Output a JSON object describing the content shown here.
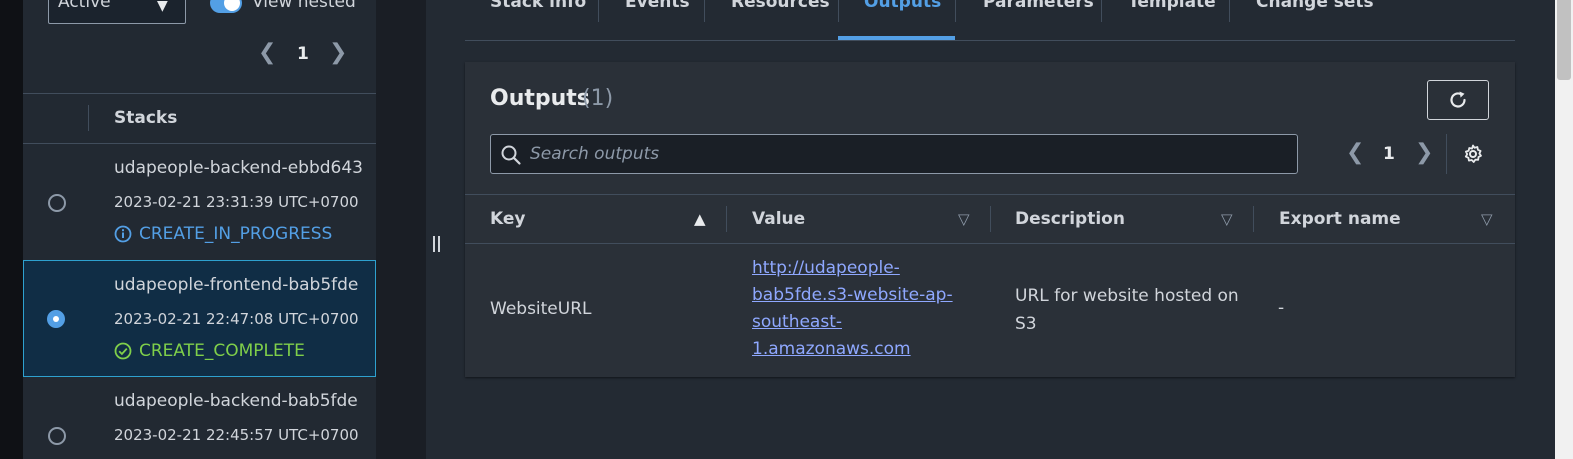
{
  "colors": {
    "accent": "#539fe5",
    "link": "#8fa8ff",
    "in_progress": "#539fe5",
    "complete": "#7fcf4a",
    "selected_border": "#2ea1cf"
  },
  "filter": {
    "select_value": "Active",
    "toggle_label": "View nested",
    "toggle_on": true
  },
  "stacks_pager": {
    "page": "1"
  },
  "stacks_header": {
    "column": "Stacks"
  },
  "stacks": [
    {
      "name": "udapeople-backend-ebbd643",
      "time": "2023-02-21 23:31:39 UTC+0700",
      "status": "CREATE_IN_PROGRESS",
      "status_icon": "info-icon",
      "selected": false
    },
    {
      "name": "udapeople-frontend-bab5fde",
      "time": "2023-02-21 22:47:08 UTC+0700",
      "status": "CREATE_COMPLETE",
      "status_icon": "check-circle-icon",
      "selected": true
    },
    {
      "name": "udapeople-backend-bab5fde",
      "time": "2023-02-21 22:45:57 UTC+0700",
      "status": "",
      "status_icon": "",
      "selected": false
    }
  ],
  "tabs": [
    {
      "label": "Stack info",
      "active": false
    },
    {
      "label": "Events",
      "active": false
    },
    {
      "label": "Resources",
      "active": false
    },
    {
      "label": "Outputs",
      "active": true
    },
    {
      "label": "Parameters",
      "active": false
    },
    {
      "label": "Template",
      "active": false
    },
    {
      "label": "Change sets",
      "active": false
    }
  ],
  "outputs": {
    "title": "Outputs",
    "count": "(1)",
    "search_placeholder": "Search outputs",
    "page": "1",
    "columns": [
      "Key",
      "Value",
      "Description",
      "Export name"
    ],
    "rows": [
      {
        "key": "WebsiteURL",
        "value_lines": [
          "http://udapeople-",
          "bab5fde.s3-website-ap-",
          "southeast-",
          "1.amazonaws.com"
        ],
        "description_lines": [
          "URL for website hosted on",
          "S3"
        ],
        "export_name": "-"
      }
    ]
  }
}
